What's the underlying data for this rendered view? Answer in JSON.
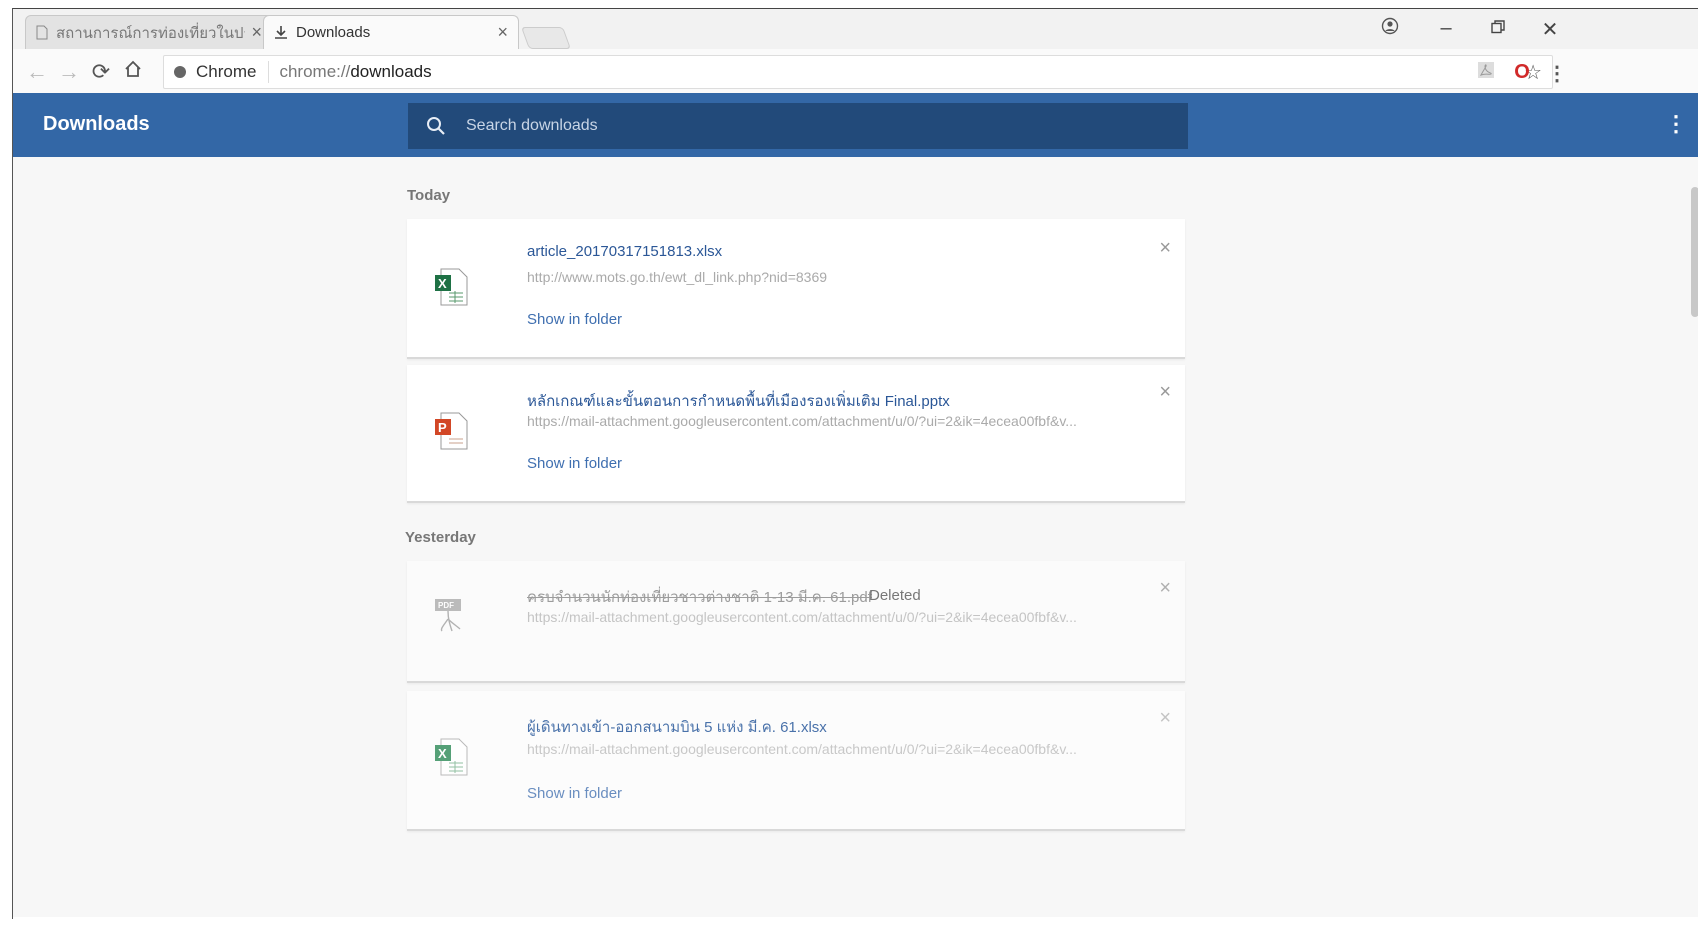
{
  "browser": {
    "tabs": [
      {
        "title": "สถานการณ์การท่องเที่ยวในประเทศ",
        "active": false
      },
      {
        "title": "Downloads",
        "active": true
      }
    ],
    "omnibox": {
      "chip": "Chrome",
      "scheme": "chrome://",
      "path": "downloads"
    }
  },
  "page": {
    "title": "Downloads",
    "search_placeholder": "Search downloads"
  },
  "groups": [
    {
      "label": "Today"
    },
    {
      "label": "Yesterday"
    }
  ],
  "items": [
    {
      "filename": "article_20170317151813.xlsx",
      "url": "http://www.mots.go.th/ewt_dl_link.php?nid=8369",
      "action": "Show in folder",
      "type": "xlsx",
      "status": ""
    },
    {
      "filename": "หลักเกณฑ์และขั้นตอนการกำหนดพื้นที่เมืองรองเพิ่มเติม Final.pptx",
      "url": "https://mail-attachment.googleusercontent.com/attachment/u/0/?ui=2&ik=4ecea00fbf&v...",
      "action": "Show in folder",
      "type": "pptx",
      "status": ""
    },
    {
      "filename": "ครบจำนวนนักท่องเที่ยวชาวต่างชาติ 1-13 มี.ค. 61.pdf",
      "url": "https://mail-attachment.googleusercontent.com/attachment/u/0/?ui=2&ik=4ecea00fbf&v...",
      "action": "",
      "type": "pdf",
      "status": "Deleted"
    },
    {
      "filename": "ผู้เดินทางเข้า-ออกสนามบิน 5 แห่ง มี.ค. 61.xlsx",
      "url": "https://mail-attachment.googleusercontent.com/attachment/u/0/?ui=2&ik=4ecea00fbf&v...",
      "action": "Show in folder",
      "type": "xlsx",
      "status": ""
    }
  ],
  "colors": {
    "header": "#3367a6",
    "search_bg": "#224a7a",
    "link": "#2b5797"
  }
}
